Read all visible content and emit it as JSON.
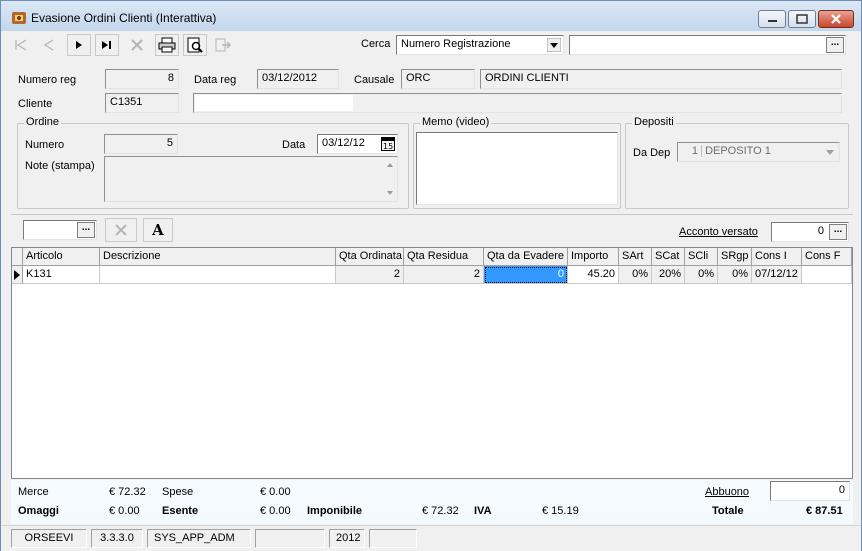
{
  "window": {
    "title": "Evasione Ordini Clienti (Interattiva)"
  },
  "toolbar": {
    "search_label": "Cerca",
    "search_field_value": "Numero Registrazione",
    "search_text_value": "",
    "icons": [
      "first-record-icon",
      "previous-record-icon",
      "next-record-icon",
      "last-record-icon",
      "delete-icon",
      "print-icon",
      "print-preview-icon",
      "export-icon"
    ]
  },
  "header": {
    "numero_reg_label": "Numero reg",
    "numero_reg_value": "8",
    "data_reg_label": "Data reg",
    "data_reg_value": "03/12/2012",
    "causale_label": "Causale",
    "causale_code": "ORC",
    "causale_desc": "ORDINI CLIENTI",
    "cliente_label": "Cliente",
    "cliente_code": "C1351",
    "cliente_name": ""
  },
  "ordine": {
    "group_title": "Ordine",
    "numero_label": "Numero",
    "numero_value": "5",
    "data_label": "Data",
    "data_value": "03/12/12",
    "note_label": "Note (stampa)",
    "note_value": ""
  },
  "memo": {
    "group_title": "Memo (video)",
    "value": ""
  },
  "depositi": {
    "group_title": "Depositi",
    "da_dep_label": "Da Dep",
    "dep_code": "1",
    "dep_name": "DEPOSITO 1"
  },
  "midbar": {
    "text_button_glyph": "A",
    "acconto_label": "Acconto versato",
    "acconto_value": "0"
  },
  "grid": {
    "columns": [
      "Articolo",
      "Descrizione",
      "Qta Ordinata",
      "Qta Residua",
      "Qta da Evadere",
      "Importo",
      "SArt",
      "SCat",
      "SCli",
      "SRgp",
      "Cons I",
      "Cons F"
    ],
    "rows": [
      {
        "articolo": "K131",
        "descrizione": "",
        "qta_ordinata": "2",
        "qta_residua": "2",
        "qta_evadere": "0",
        "importo": "45.20",
        "sart": "0%",
        "scat": "20%",
        "scli": "0%",
        "srgp": "0%",
        "cons_i": "07/12/12",
        "cons_f": ""
      }
    ]
  },
  "totals": {
    "merce_label": "Merce",
    "merce_value": "€ 72.32",
    "spese_label": "Spese",
    "spese_value": "€ 0.00",
    "abbuono_label": "Abbuono",
    "abbuono_value": "0",
    "omaggi_label": "Omaggi",
    "omaggi_value": "€ 0.00",
    "esente_label": "Esente",
    "esente_value": "€ 0.00",
    "imponibile_label": "Imponibile",
    "imponibile_value": "€ 72.32",
    "iva_label": "IVA",
    "iva_value": "€ 15.19",
    "totale_label": "Totale",
    "totale_value": "€ 87.51"
  },
  "statusbar": {
    "app": "ORSEEVI",
    "version": "3.3.3.0",
    "user": "SYS_APP_ADM",
    "blank": "",
    "year": "2012",
    "extra": ""
  }
}
